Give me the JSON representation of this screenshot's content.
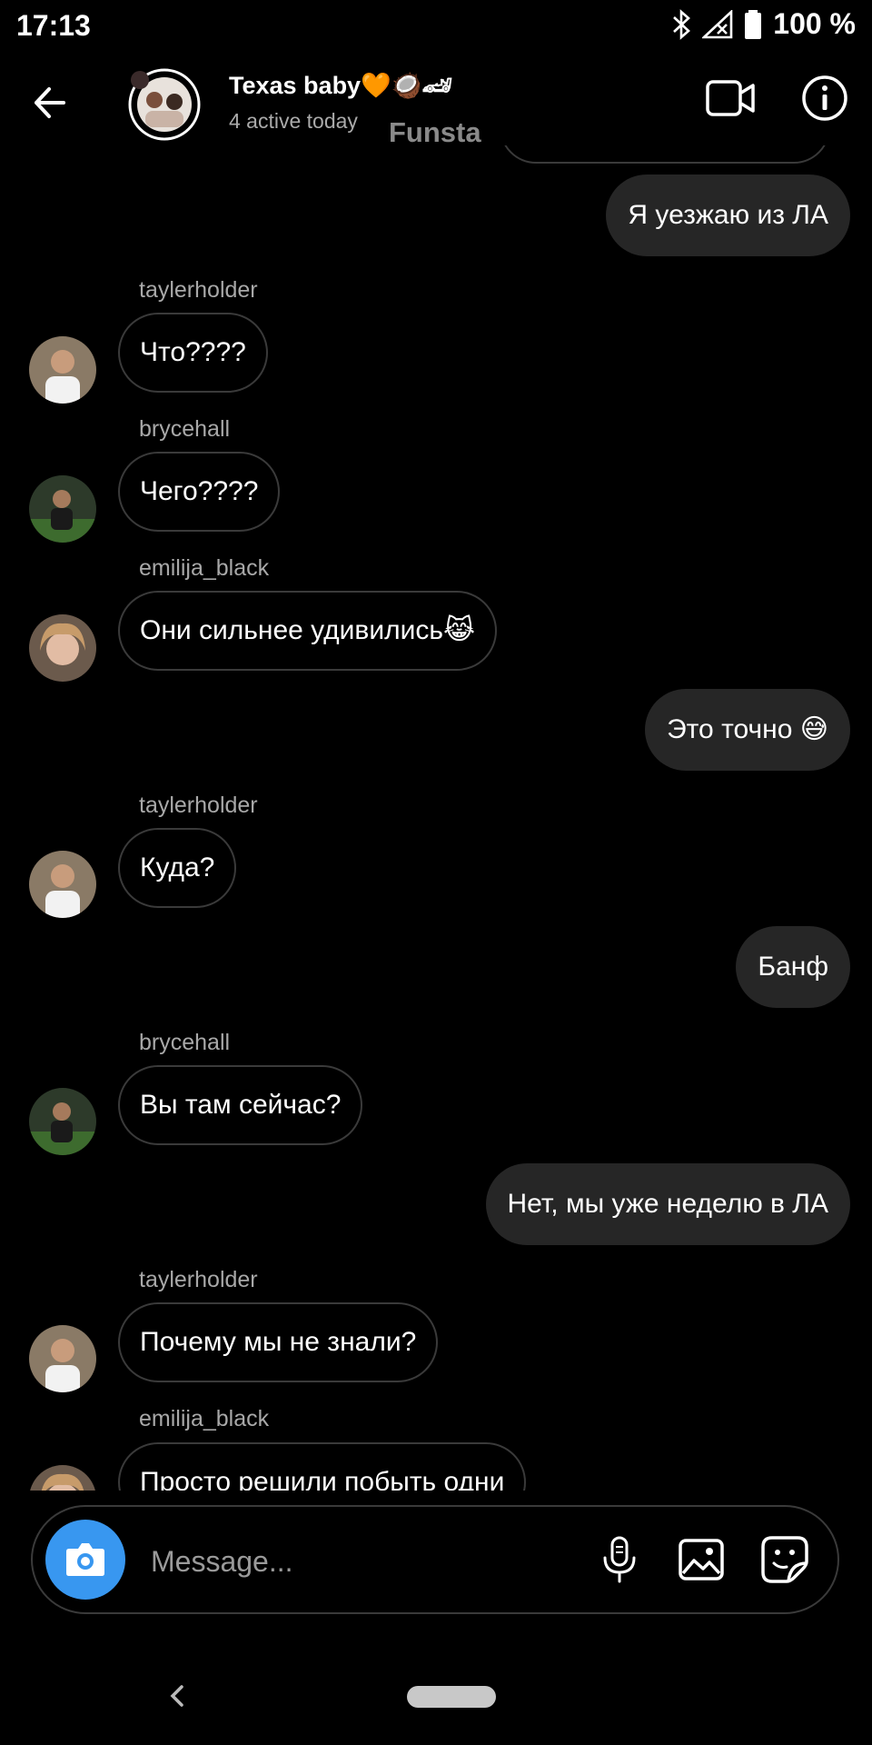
{
  "status_bar": {
    "time": "17:13",
    "battery": "100 %"
  },
  "header": {
    "title": "Texas baby🧡🥥🏎",
    "subtitle": "4 active today",
    "watermark": "Funsta"
  },
  "messages": [
    {
      "dir": "out",
      "text": "Я уезжаю из ЛА"
    },
    {
      "dir": "in",
      "sender": "taylerholder",
      "text": "Что????"
    },
    {
      "dir": "in",
      "sender": "brycehall",
      "text": "Чего????"
    },
    {
      "dir": "in",
      "sender": "emilija_black",
      "text": "Они сильнее удивились😹"
    },
    {
      "dir": "out",
      "text": "Это точно 😅"
    },
    {
      "dir": "in",
      "sender": "taylerholder",
      "text": "Куда?"
    },
    {
      "dir": "out",
      "text": "Банф"
    },
    {
      "dir": "in",
      "sender": "brycehall",
      "text": "Вы там сейчас?"
    },
    {
      "dir": "out",
      "text": "Нет, мы уже неделю в ЛА"
    },
    {
      "dir": "in",
      "sender": "taylerholder",
      "text": "Почему мы не знали?"
    },
    {
      "dir": "in",
      "sender": "emilija_black",
      "text": "Просто решили побыть одни"
    }
  ],
  "composer": {
    "placeholder": "Message..."
  },
  "colors": {
    "accent": "#3897f0",
    "bubble_out": "#262626",
    "bubble_in_border": "#3a3a3a"
  },
  "icons": [
    "back-arrow-icon",
    "video-call-icon",
    "info-icon",
    "camera-icon",
    "microphone-icon",
    "gallery-icon",
    "sticker-icon",
    "bluetooth-icon",
    "signal-icon",
    "battery-icon"
  ]
}
